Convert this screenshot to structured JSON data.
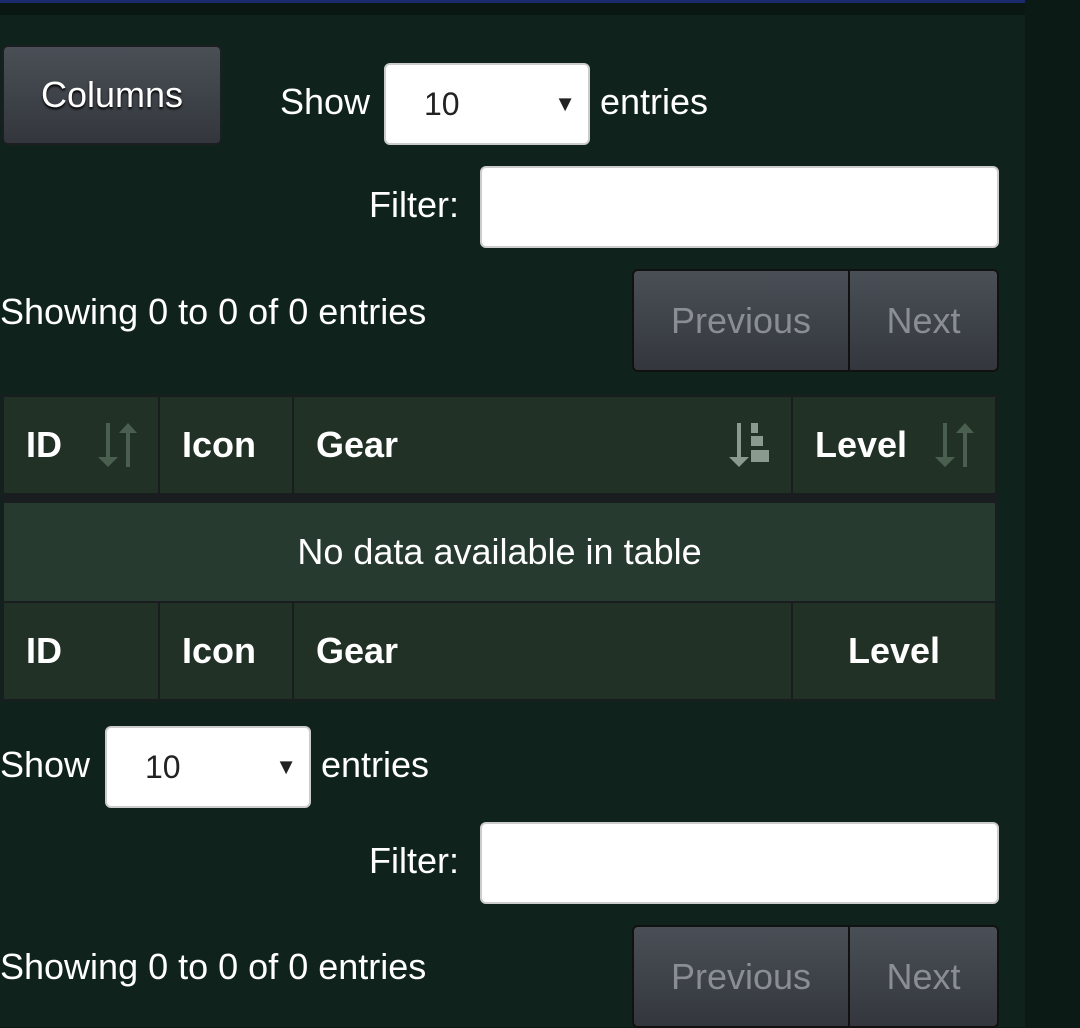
{
  "toolbar": {
    "columns_label": "Columns"
  },
  "top": {
    "show_label": "Show",
    "page_size": "10",
    "entries_label": "entries",
    "filter_label": "Filter:",
    "filter_value": "",
    "info": "Showing 0 to 0 of 0 entries",
    "previous": "Previous",
    "next": "Next"
  },
  "table": {
    "headers": [
      {
        "label": "ID",
        "sort": "unsorted"
      },
      {
        "label": "Icon",
        "sort": "none"
      },
      {
        "label": "Gear",
        "sort": "descending"
      },
      {
        "label": "Level",
        "sort": "unsorted"
      }
    ],
    "empty_message": "No data available in table",
    "footers": [
      "ID",
      "Icon",
      "Gear",
      "Level"
    ]
  },
  "bottom": {
    "show_label": "Show",
    "page_size": "10",
    "entries_label": "entries",
    "filter_label": "Filter:",
    "filter_value": "",
    "info": "Showing 0 to 0 of 0 entries",
    "previous": "Previous",
    "next": "Next"
  }
}
